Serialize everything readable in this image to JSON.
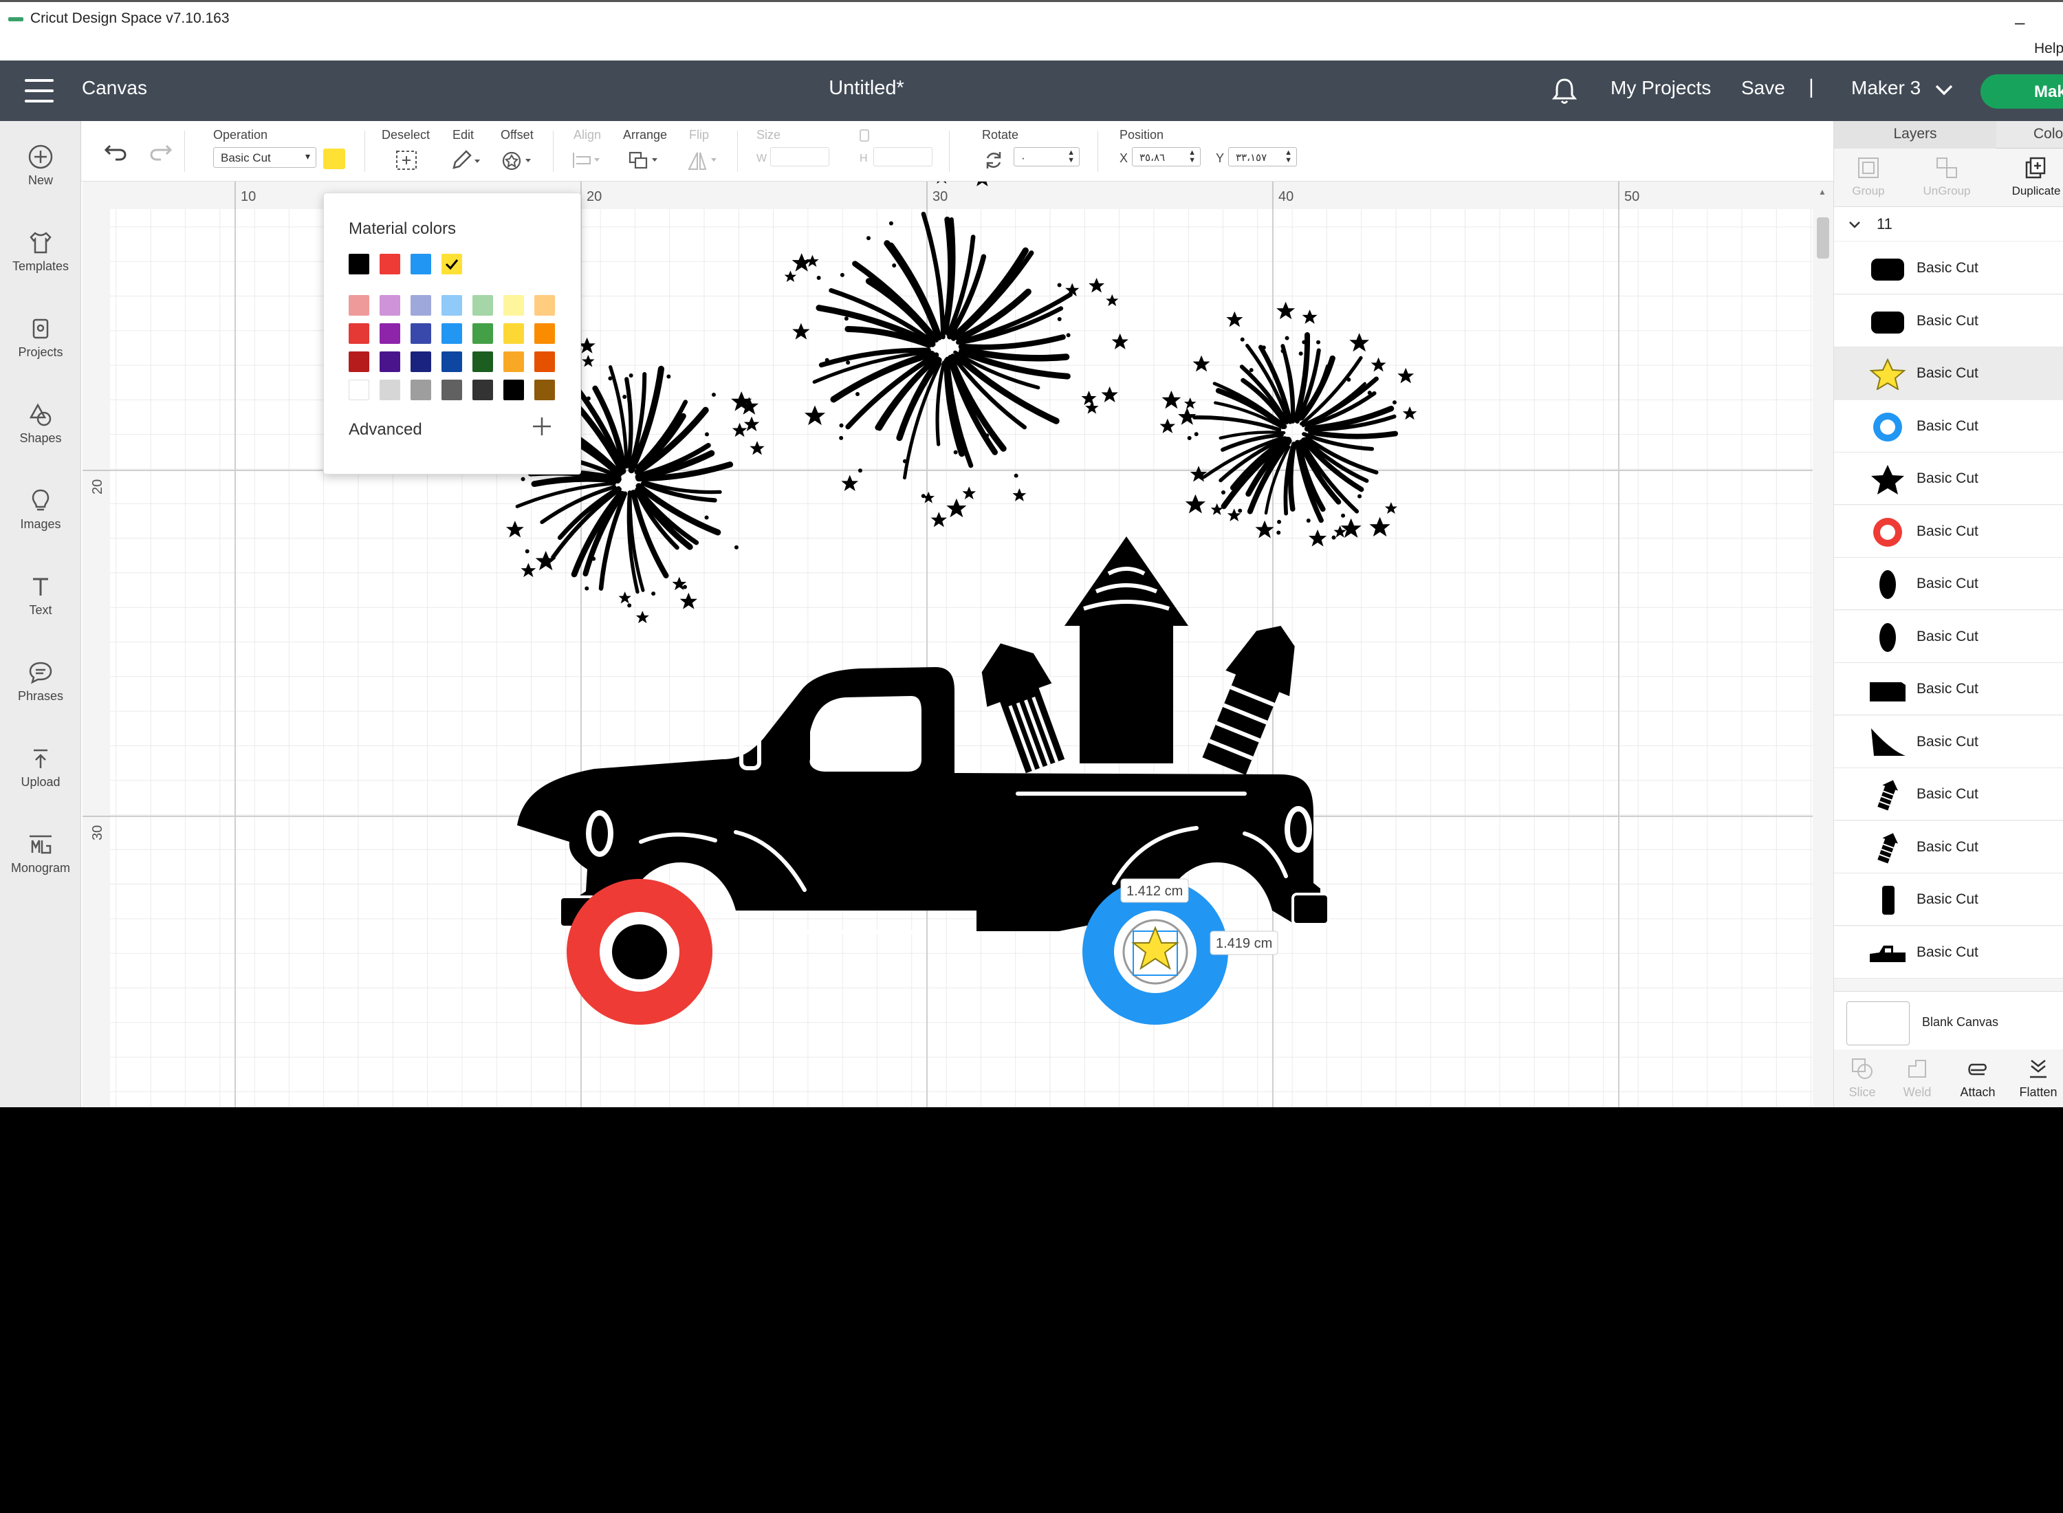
{
  "window": {
    "title": "Cricut Design Space  v7.10.163",
    "help": "Help",
    "minimize": "–"
  },
  "header": {
    "canvas_label": "Canvas",
    "document_title": "Untitled*",
    "my_projects": "My Projects",
    "save": "Save",
    "separator": "|",
    "machine": "Maker 3",
    "make": "Make"
  },
  "sidebar": {
    "items": [
      {
        "label": "New",
        "icon": "plus-circle-icon"
      },
      {
        "label": "Templates",
        "icon": "shirt-icon"
      },
      {
        "label": "Projects",
        "icon": "projects-icon"
      },
      {
        "label": "Shapes",
        "icon": "shapes-icon"
      },
      {
        "label": "Images",
        "icon": "lightbulb-icon"
      },
      {
        "label": "Text",
        "icon": "text-icon"
      },
      {
        "label": "Phrases",
        "icon": "speech-bubble-icon"
      },
      {
        "label": "Upload",
        "icon": "upload-icon"
      },
      {
        "label": "Monogram",
        "icon": "monogram-icon"
      }
    ]
  },
  "toolbar": {
    "operation_label": "Operation",
    "operation_value": "Basic Cut",
    "operation_color": "#FFE135",
    "deselect_label": "Deselect",
    "edit_label": "Edit",
    "offset_label": "Offset",
    "align_label": "Align",
    "arrange_label": "Arrange",
    "flip_label": "Flip",
    "size_label": "Size",
    "w_label": "W",
    "h_label": "H",
    "rotate_label": "Rotate",
    "rotate_value": "·",
    "position_label": "Position",
    "x_label": "X",
    "x_value": "٣٥،٨٦",
    "y_label": "Y",
    "y_value": "٣٣،١٥٧"
  },
  "ruler": {
    "top_ticks": [
      "10",
      "20",
      "30",
      "40",
      "50"
    ],
    "left_ticks": [
      "20",
      "30"
    ]
  },
  "color_picker": {
    "title": "Material colors",
    "recent": [
      "#000000",
      "#EE3B36",
      "#2196F3",
      "#FFE135"
    ],
    "selected_index": 3,
    "palette": [
      [
        "#EF9A9A",
        "#CE93D8",
        "#9FA8DA",
        "#90CAF9",
        "#A5D6A7",
        "#FFF59D",
        "#FFCC80"
      ],
      [
        "#E53935",
        "#8E24AA",
        "#3949AB",
        "#2196F3",
        "#43A047",
        "#FDD835",
        "#FB8C00"
      ],
      [
        "#B71C1C",
        "#4A148C",
        "#1A237E",
        "#0D47A1",
        "#1B5E20",
        "#F9A825",
        "#E65100"
      ],
      [
        "#FFFFFF",
        "#D6D6D6",
        "#9E9E9E",
        "#616161",
        "#333333",
        "#000000",
        "#8D5A0A"
      ]
    ],
    "advanced_label": "Advanced"
  },
  "measurements": {
    "width": "1.412 cm",
    "height": "1.419 cm"
  },
  "layers_panel": {
    "tabs": [
      "Layers",
      "Color"
    ],
    "tools": [
      {
        "label": "Group",
        "enabled": false
      },
      {
        "label": "UnGroup",
        "enabled": false
      },
      {
        "label": "Duplicate",
        "enabled": true
      }
    ],
    "group_name": "11",
    "layers": [
      {
        "name": "Basic Cut",
        "icon": "rounded-rect-icon",
        "highlighted": false
      },
      {
        "name": "Basic Cut",
        "icon": "rounded-rect-icon",
        "highlighted": false
      },
      {
        "name": "Basic Cut",
        "icon": "yellow-star-icon",
        "highlighted": true
      },
      {
        "name": "Basic Cut",
        "icon": "blue-ring-icon",
        "highlighted": false
      },
      {
        "name": "Basic Cut",
        "icon": "black-star-icon",
        "highlighted": false
      },
      {
        "name": "Basic Cut",
        "icon": "red-ring-icon",
        "highlighted": false
      },
      {
        "name": "Basic Cut",
        "icon": "oval-icon",
        "highlighted": false
      },
      {
        "name": "Basic Cut",
        "icon": "oval-icon",
        "highlighted": false
      },
      {
        "name": "Basic Cut",
        "icon": "truck-bed-icon",
        "highlighted": false
      },
      {
        "name": "Basic Cut",
        "icon": "fender-icon",
        "highlighted": false
      },
      {
        "name": "Basic Cut",
        "icon": "firework-rocket-icon",
        "highlighted": false
      },
      {
        "name": "Basic Cut",
        "icon": "firework-rocket-icon",
        "highlighted": false
      },
      {
        "name": "Basic Cut",
        "icon": "rocket-tube-icon",
        "highlighted": false
      },
      {
        "name": "Basic Cut",
        "icon": "truck-icon",
        "highlighted": false
      }
    ],
    "blank_canvas": "Blank Canvas",
    "bottom_tools": [
      {
        "label": "Slice",
        "enabled": false
      },
      {
        "label": "Weld",
        "enabled": false
      },
      {
        "label": "Attach",
        "enabled": true
      },
      {
        "label": "Flatten",
        "enabled": true
      }
    ]
  }
}
